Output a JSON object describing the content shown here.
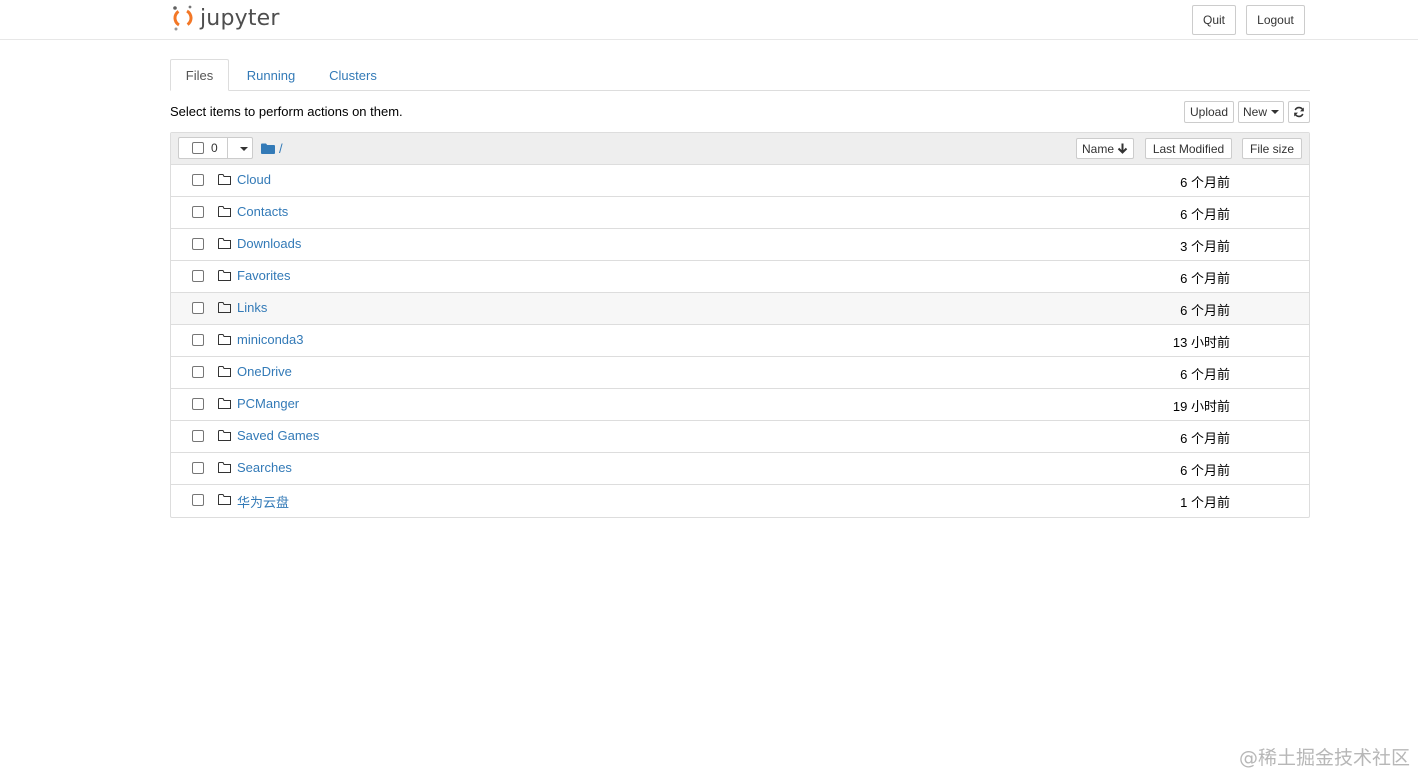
{
  "header": {
    "logo_text": "jupyter",
    "quit_label": "Quit",
    "logout_label": "Logout"
  },
  "tabs": [
    {
      "label": "Files",
      "active": true
    },
    {
      "label": "Running",
      "active": false
    },
    {
      "label": "Clusters",
      "active": false
    }
  ],
  "toolbar": {
    "hint": "Select items to perform actions on them.",
    "upload_label": "Upload",
    "new_label": "New",
    "refresh_icon": "refresh-icon"
  },
  "list_header": {
    "selected_count": "0",
    "breadcrumb_path": "/",
    "sort_name_label": "Name",
    "sort_modified_label": "Last Modified",
    "sort_size_label": "File size"
  },
  "files": [
    {
      "name": "Cloud",
      "modified": "6 个月前"
    },
    {
      "name": "Contacts",
      "modified": "6 个月前"
    },
    {
      "name": "Downloads",
      "modified": "3 个月前"
    },
    {
      "name": "Favorites",
      "modified": "6 个月前"
    },
    {
      "name": "Links",
      "modified": "6 个月前"
    },
    {
      "name": "miniconda3",
      "modified": "13 小时前"
    },
    {
      "name": "OneDrive",
      "modified": "6 个月前"
    },
    {
      "name": "PCManger",
      "modified": "19 小时前"
    },
    {
      "name": "Saved Games",
      "modified": "6 个月前"
    },
    {
      "name": "Searches",
      "modified": "6 个月前"
    },
    {
      "name": "华为云盘",
      "modified": "1 个月前"
    }
  ],
  "watermark": "@稀土掘金技术社区",
  "colors": {
    "link": "#337ab7",
    "logo_orange": "#f37726",
    "header_bg": "#eeeeee"
  }
}
